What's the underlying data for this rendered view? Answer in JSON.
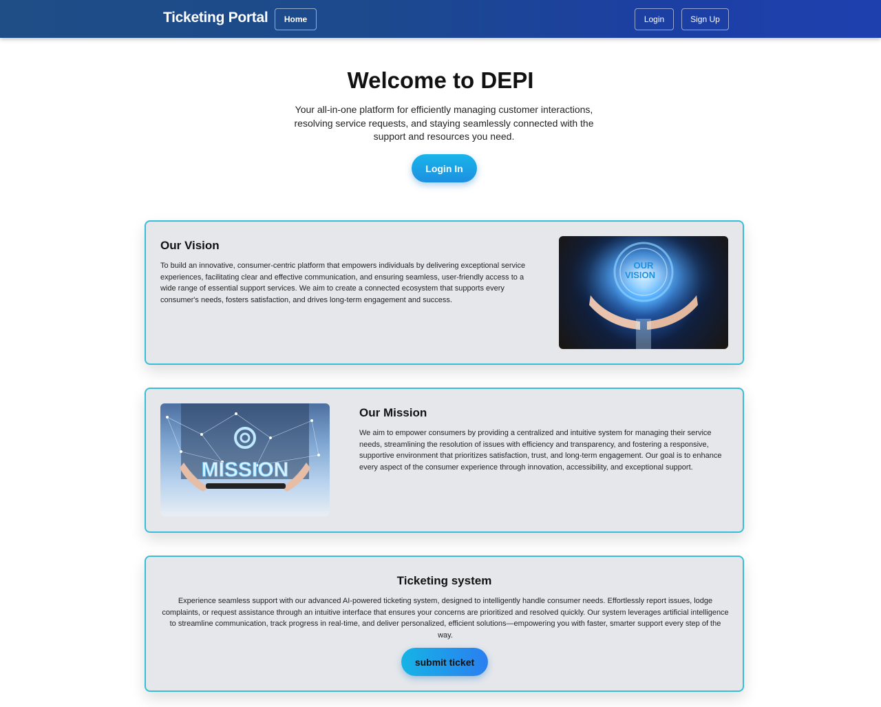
{
  "navbar": {
    "brand": "Ticketing Portal",
    "home_label": "Home",
    "login_label": "Login",
    "signup_label": "Sign Up"
  },
  "hero": {
    "title": "Welcome to DEPI",
    "subtitle": "Your all-in-one platform for efficiently managing customer interactions, resolving service requests, and staying seamlessly connected with the support and resources you need.",
    "button_label": "Login In"
  },
  "vision": {
    "title": "Our Vision",
    "text": "To build an innovative, consumer-centric platform that empowers individuals by delivering exceptional service experiences, facilitating clear and effective communication, and ensuring seamless, user-friendly access to a wide range of essential support services. We aim to create a connected ecosystem that supports every consumer's needs, fosters satisfaction, and drives long-term engagement and success.",
    "image_caption_line1": "OUR",
    "image_caption_line2": "VISION"
  },
  "mission": {
    "title": "Our Mission",
    "text": "We aim to empower consumers by providing a centralized and intuitive system for managing their service needs, streamlining the resolution of issues with efficiency and transparency, and fostering a responsive, supportive environment that prioritizes satisfaction, trust, and long-term engagement. Our goal is to enhance every aspect of the consumer experience through innovation, accessibility, and exceptional support.",
    "image_caption": "MISSION"
  },
  "ticketing": {
    "title": "Ticketing system",
    "text": "Experience seamless support with our advanced AI-powered ticketing system, designed to intelligently handle consumer needs. Effortlessly report issues, lodge complaints, or request assistance through an intuitive interface that ensures your concerns are prioritized and resolved quickly. Our system leverages artificial intelligence to streamline communication, track progress in real-time, and deliver personalized, efficient solutions—empowering you with faster, smarter support every step of the way.",
    "button_label": "submit ticket"
  }
}
